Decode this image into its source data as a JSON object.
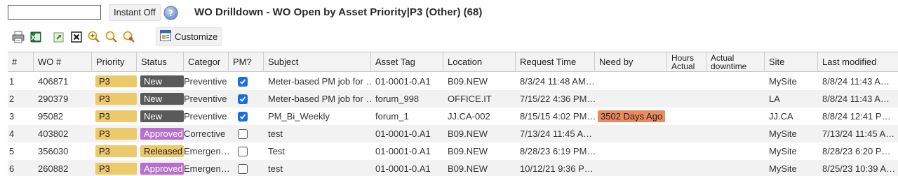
{
  "top": {
    "search_value": "",
    "instant_label": "Instant Off",
    "title": "WO Drilldown - WO Open by Asset Priority|P3 (Other) (68)"
  },
  "toolbar": {
    "customize_label": "Customize",
    "icons": [
      "print-icon",
      "excel-export-icon",
      "refresh-icon",
      "clear-filter-icon",
      "zoom-in-icon",
      "search-icon",
      "zoom-out-icon",
      "customize-icon"
    ]
  },
  "columns": [
    "#",
    "WO #",
    "Priority",
    "Status",
    "Categor",
    "PM?",
    "Subject",
    "Asset Tag",
    "Location",
    "Request Time",
    "Need by",
    "Hours Actual",
    "Actual downtime",
    "Site",
    "Last modified"
  ],
  "colors": {
    "priority": "#ecc96a",
    "status_new": "#5a5a5a",
    "status_approved": "#b76fcc",
    "status_released": "#ecc96a",
    "need_by_overdue": "#e98a61",
    "checkbox": "#1a6fe0"
  },
  "rows": [
    {
      "num": "1",
      "wo": "406871",
      "priority": "P3",
      "status": "New",
      "category": "Preventive",
      "pm": true,
      "subject": "Meter-based PM job for …",
      "asset_tag": "01-0001-0.A1",
      "location": "B09.NEW",
      "request_time": "8/3/24 11:48 AM…",
      "need_by": "",
      "hours_actual": "",
      "actual_downtime": "",
      "site": "MySite",
      "last_modified": "8/8/24 11:43 A…"
    },
    {
      "num": "2",
      "wo": "290379",
      "priority": "P3",
      "status": "New",
      "category": "Preventive",
      "pm": true,
      "subject": "Meter-based PM job for …",
      "asset_tag": "forum_998",
      "location": "OFFICE.IT",
      "request_time": "7/15/22 4:36 PM…",
      "need_by": "",
      "hours_actual": "",
      "actual_downtime": "",
      "site": "LA",
      "last_modified": "8/8/24 11:43 A…"
    },
    {
      "num": "3",
      "wo": "95082",
      "priority": "P3",
      "status": "New",
      "category": "Preventive",
      "pm": true,
      "subject": "PM_Bi_Weekly",
      "asset_tag": "forum_1",
      "location": "JJ.CA-002",
      "request_time": "8/15/15 4:02 PM…",
      "need_by": "3502 Days Ago",
      "hours_actual": "",
      "actual_downtime": "",
      "site": "JJ.CA",
      "last_modified": "8/8/24 12:41 P…"
    },
    {
      "num": "4",
      "wo": "403802",
      "priority": "P3",
      "status": "Approved",
      "category": "Corrective",
      "pm": false,
      "subject": "test",
      "asset_tag": "01-0001-0.A1",
      "location": "B09.NEW",
      "request_time": "7/13/24 11:45 A…",
      "need_by": "",
      "hours_actual": "",
      "actual_downtime": "",
      "site": "MySite",
      "last_modified": "7/13/24 11:45 A…"
    },
    {
      "num": "5",
      "wo": "356030",
      "priority": "P3",
      "status": "Released",
      "category": "Emergen…",
      "pm": false,
      "subject": "Test",
      "asset_tag": "01-0001-0.A1",
      "location": "B09.NEW",
      "request_time": "8/28/23 6:19 PM…",
      "need_by": "",
      "hours_actual": "",
      "actual_downtime": "",
      "site": "MySite",
      "last_modified": "8/28/23 6:20 P…"
    },
    {
      "num": "6",
      "wo": "260882",
      "priority": "P3",
      "status": "Approved",
      "category": "Emergen…",
      "pm": false,
      "subject": "test",
      "asset_tag": "01-0001-0.A1",
      "location": "B09.NEW",
      "request_time": "10/12/21 9:36 P…",
      "need_by": "",
      "hours_actual": "",
      "actual_downtime": "",
      "site": "MySite",
      "last_modified": "8/25/23 10:39 A…"
    }
  ]
}
